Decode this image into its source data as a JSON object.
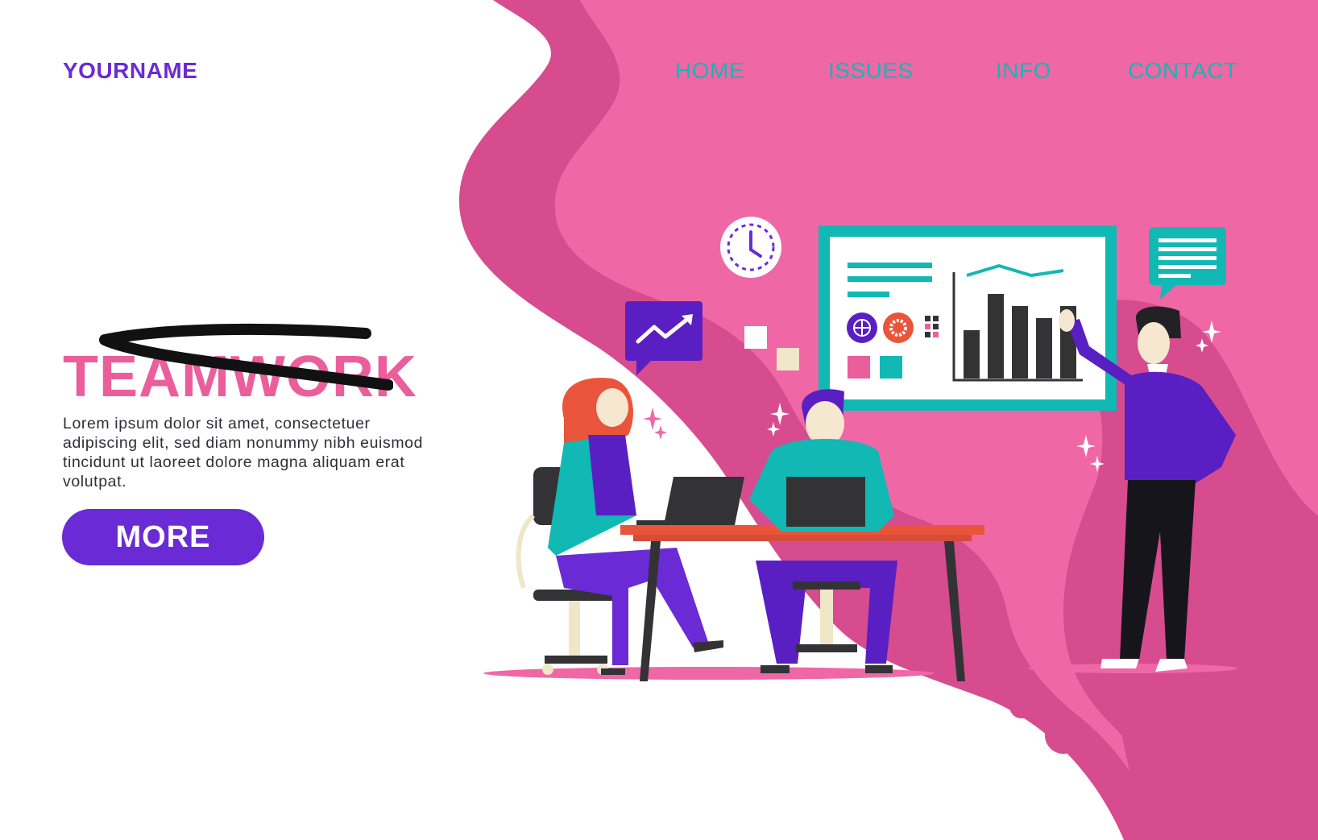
{
  "header": {
    "logo": "YOURNAME",
    "nav": [
      {
        "label": "HOME"
      },
      {
        "label": "ISSUES"
      },
      {
        "label": "INFO"
      },
      {
        "label": "CONTACT"
      }
    ]
  },
  "hero": {
    "title": "TEAMWORK",
    "body": "Lorem ipsum dolor sit amet, consectetuer adipiscing elit, sed diam nonummy nibh euismod tincidunt ut laoreet dolore magna aliquam erat volutpat.",
    "button_label": "MORE"
  },
  "illustration": {
    "icons": [
      "clock-icon",
      "trend-up-icon",
      "globe-icon",
      "gear-icon",
      "chat-bubble-icon",
      "sparkle-icon"
    ],
    "presentation_chart": {
      "type": "bar",
      "values": [
        4,
        7,
        6,
        5,
        6
      ],
      "trend": [
        3,
        5,
        3,
        4
      ]
    }
  },
  "colors": {
    "brand_purple": "#6a2bd6",
    "accent_teal": "#11b8b4",
    "accent_pink": "#ea5f9b",
    "blob_pink": "#f067a6",
    "blob_dark_pink": "#d64c8e",
    "desk_red": "#e9553b",
    "ink": "#2e2e3a"
  }
}
